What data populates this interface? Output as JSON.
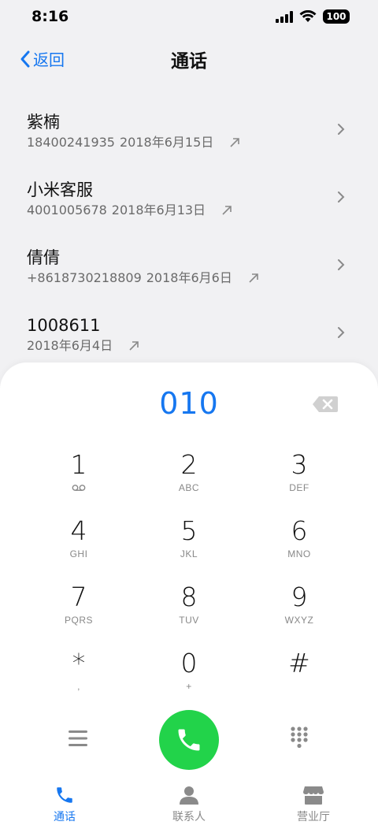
{
  "status_bar": {
    "time": "8:16",
    "battery": "100"
  },
  "header": {
    "back_label": "返回",
    "title": "通话"
  },
  "calls": [
    {
      "name": "紫楠",
      "number": "18400241935",
      "date": "2018年6月15日"
    },
    {
      "name": "小米客服",
      "number": "4001005678",
      "date": "2018年6月13日"
    },
    {
      "name": "倩倩",
      "number": "+8618730218809",
      "date": "2018年6月6日"
    },
    {
      "name": "1008611",
      "number": "",
      "date": "2018年6月4日"
    }
  ],
  "dialpad": {
    "dialed": "010",
    "keys": [
      {
        "digit": "1",
        "letters": ""
      },
      {
        "digit": "2",
        "letters": "ABC"
      },
      {
        "digit": "3",
        "letters": "DEF"
      },
      {
        "digit": "4",
        "letters": "GHI"
      },
      {
        "digit": "5",
        "letters": "JKL"
      },
      {
        "digit": "6",
        "letters": "MNO"
      },
      {
        "digit": "7",
        "letters": "PQRS"
      },
      {
        "digit": "8",
        "letters": "TUV"
      },
      {
        "digit": "9",
        "letters": "WXYZ"
      },
      {
        "digit": "*",
        "letters": ","
      },
      {
        "digit": "0",
        "letters": "+"
      },
      {
        "digit": "#",
        "letters": ""
      }
    ]
  },
  "tabs": [
    {
      "label": "通话",
      "icon": "phone-icon",
      "active": true
    },
    {
      "label": "联系人",
      "icon": "person-icon",
      "active": false
    },
    {
      "label": "营业厅",
      "icon": "store-icon",
      "active": false
    }
  ],
  "colors": {
    "accent": "#1677f0",
    "call_green": "#22d34a",
    "icon_gray": "#8a8a8a"
  }
}
